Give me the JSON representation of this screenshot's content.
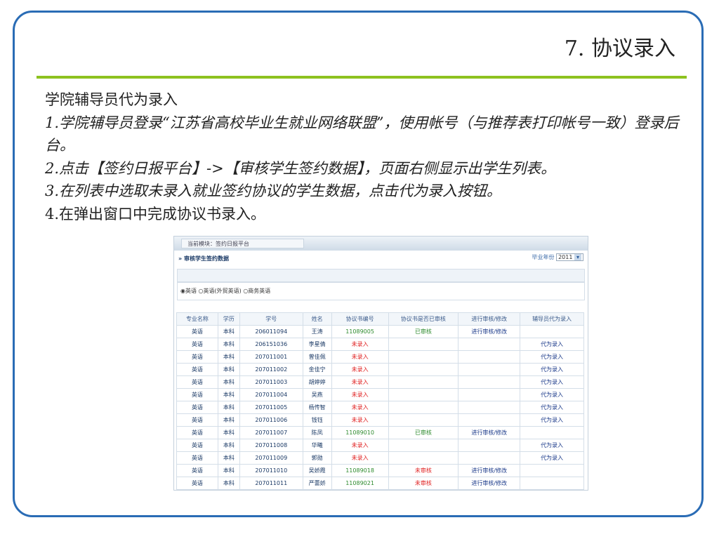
{
  "slide": {
    "title": "7. 协议录入",
    "lines": [
      "学院辅导员代为录入",
      "1.学院辅导员登录“江苏省高校毕业生就业网络联盟”，使用帐号（与推荐表打印帐号一致）登录后台。",
      "2.点击【签约日报平台】->【审核学生签约数据】，页面右侧显示出学生列表。",
      "3.在列表中选取未录入就业签约协议的学生数据，点击代为录入按钮。",
      "4.在弹出窗口中完成协议书录入。"
    ]
  },
  "app": {
    "module": "当前模块：签约日报平台",
    "heading": "审核学生签约数据",
    "year_label": "毕业年份",
    "year_value": "2011",
    "radios": [
      "英语",
      "英语(外贸英语)",
      "商务英语"
    ],
    "columns": [
      "专业名称",
      "学历",
      "学号",
      "姓名",
      "协议书编号",
      "协议书是否已审核",
      "进行审核/修改",
      "辅导员代为录入"
    ],
    "rows": [
      [
        "英语",
        "本科",
        "206011094",
        "王涛",
        "11089005",
        "已审核",
        "进行审核/修改",
        ""
      ],
      [
        "英语",
        "本科",
        "206151036",
        "李星倩",
        "未录入",
        "",
        "",
        "代为录入"
      ],
      [
        "英语",
        "本科",
        "207011001",
        "曾佳佩",
        "未录入",
        "",
        "",
        "代为录入"
      ],
      [
        "英语",
        "本科",
        "207011002",
        "金佳宁",
        "未录入",
        "",
        "",
        "代为录入"
      ],
      [
        "英语",
        "本科",
        "207011003",
        "胡婷婷",
        "未录入",
        "",
        "",
        "代为录入"
      ],
      [
        "英语",
        "本科",
        "207011004",
        "吴燕",
        "未录入",
        "",
        "",
        "代为录入"
      ],
      [
        "英语",
        "本科",
        "207011005",
        "杨传智",
        "未录入",
        "",
        "",
        "代为录入"
      ],
      [
        "英语",
        "本科",
        "207011006",
        "钱钰",
        "未录入",
        "",
        "",
        "代为录入"
      ],
      [
        "英语",
        "本科",
        "207011007",
        "陈凤",
        "11089010",
        "已审核",
        "进行审核/修改",
        ""
      ],
      [
        "英语",
        "本科",
        "207011008",
        "华曦",
        "未录入",
        "",
        "",
        "代为录入"
      ],
      [
        "英语",
        "本科",
        "207011009",
        "郭勋",
        "未录入",
        "",
        "",
        "代为录入"
      ],
      [
        "英语",
        "本科",
        "207011010",
        "吴娇霞",
        "11089018",
        "未审核",
        "进行审核/修改",
        ""
      ],
      [
        "英语",
        "本科",
        "207011011",
        "严蕾娇",
        "11089021",
        "未审核",
        "进行审核/修改",
        ""
      ]
    ]
  }
}
